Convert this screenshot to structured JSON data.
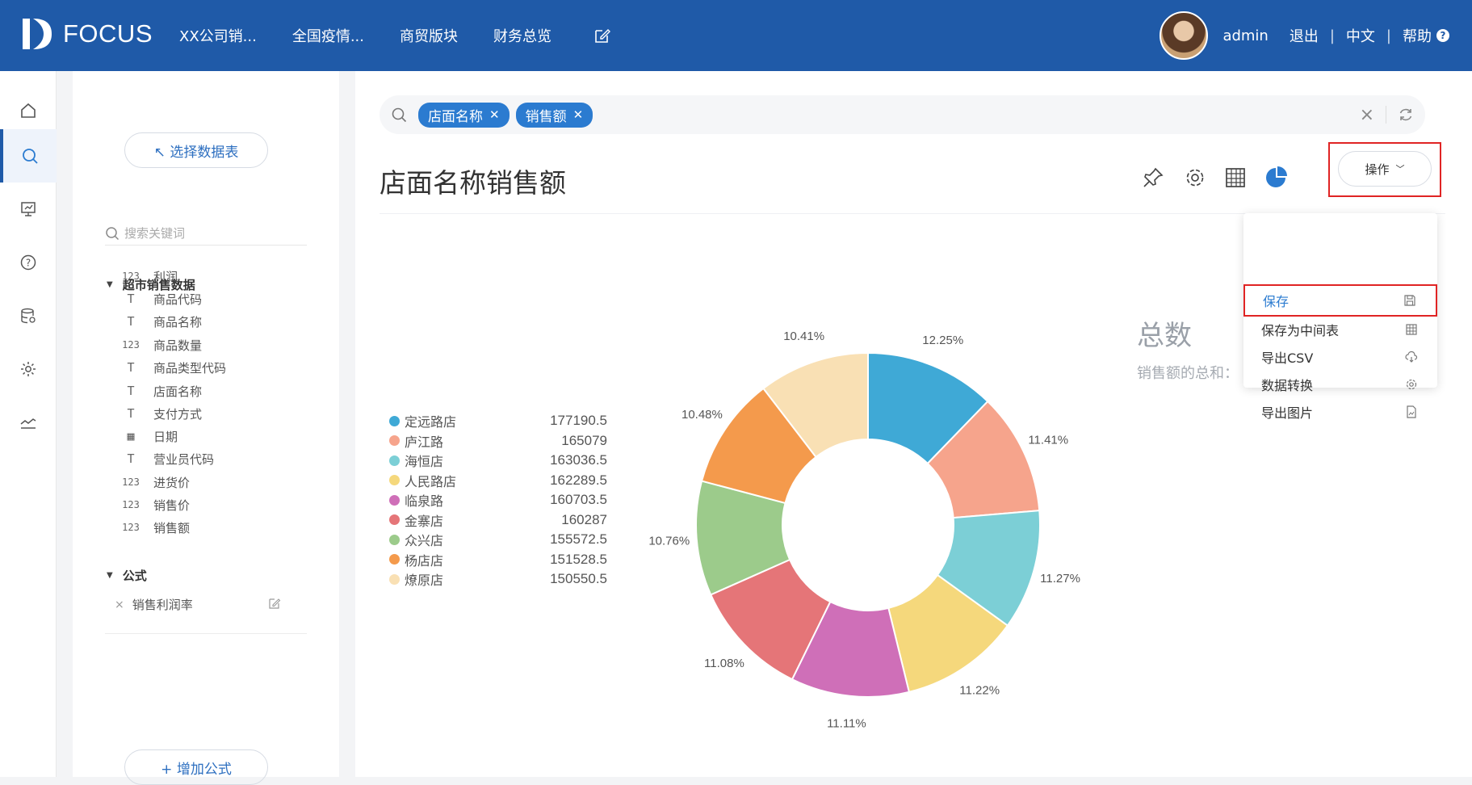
{
  "header": {
    "logo_text": "FOCUS",
    "nav": [
      "XX公司销...",
      "全国疫情...",
      "商贸版块",
      "财务总览"
    ],
    "user": "admin",
    "logout": "退出",
    "language": "中文",
    "help": "帮助"
  },
  "panel": {
    "pick_table": "↖ 选择数据表",
    "search_placeholder": "搜索关键词",
    "group_title": "超市销售数据",
    "fields": [
      {
        "icon": "123",
        "name": "利润"
      },
      {
        "icon": "T",
        "name": "商品代码"
      },
      {
        "icon": "T",
        "name": "商品名称"
      },
      {
        "icon": "123",
        "name": "商品数量"
      },
      {
        "icon": "T",
        "name": "商品类型代码"
      },
      {
        "icon": "T",
        "name": "店面名称"
      },
      {
        "icon": "T",
        "name": "支付方式"
      },
      {
        "icon": "cal",
        "name": "日期"
      },
      {
        "icon": "T",
        "name": "营业员代码"
      },
      {
        "icon": "123",
        "name": "进货价"
      },
      {
        "icon": "123",
        "name": "销售价"
      },
      {
        "icon": "123",
        "name": "销售额"
      }
    ],
    "formula_title": "公式",
    "formula_item": "销售利润率",
    "add_formula": "+ 增加公式"
  },
  "search": {
    "tags": [
      "店面名称",
      "销售额"
    ]
  },
  "main": {
    "title": "店面名称销售额",
    "ops_label": "操作",
    "menu": [
      {
        "label": "保存",
        "icon": "save-icon"
      },
      {
        "label": "保存为中间表",
        "icon": "table-icon"
      },
      {
        "label": "导出CSV",
        "icon": "cloud-download-icon"
      },
      {
        "label": "数据转换",
        "icon": "gear-icon"
      },
      {
        "label": "导出图片",
        "icon": "image-file-icon"
      }
    ],
    "summary_title": "总数",
    "summary_sub": "销售额的总和："
  },
  "chart_data": {
    "type": "pie",
    "donut": true,
    "categories": [
      "定远路店",
      "庐江路",
      "海恒店",
      "人民路店",
      "临泉路",
      "金寨店",
      "众兴店",
      "杨店店",
      "燎原店"
    ],
    "values": [
      177190.5,
      165079,
      163036.5,
      162289.5,
      160703.5,
      160287,
      155572.5,
      151528.5,
      150550.5
    ],
    "value_labels": [
      "177190.5",
      "165079",
      "163036.5",
      "162289.5",
      "160703.5",
      "160287",
      "155572.5",
      "151528.5",
      "150550.5"
    ],
    "percent_labels": [
      "12.25%",
      "11.41%",
      "11.27%",
      "11.22%",
      "11.11%",
      "11.08%",
      "10.76%",
      "10.48%",
      "10.41%"
    ],
    "colors": [
      "#3fa9d6",
      "#f6a48c",
      "#7ccfd6",
      "#f5d87c",
      "#cf6fb8",
      "#e57578",
      "#9ccb8b",
      "#f49a4c",
      "#f9e0b4"
    ],
    "legend_position": "left"
  }
}
